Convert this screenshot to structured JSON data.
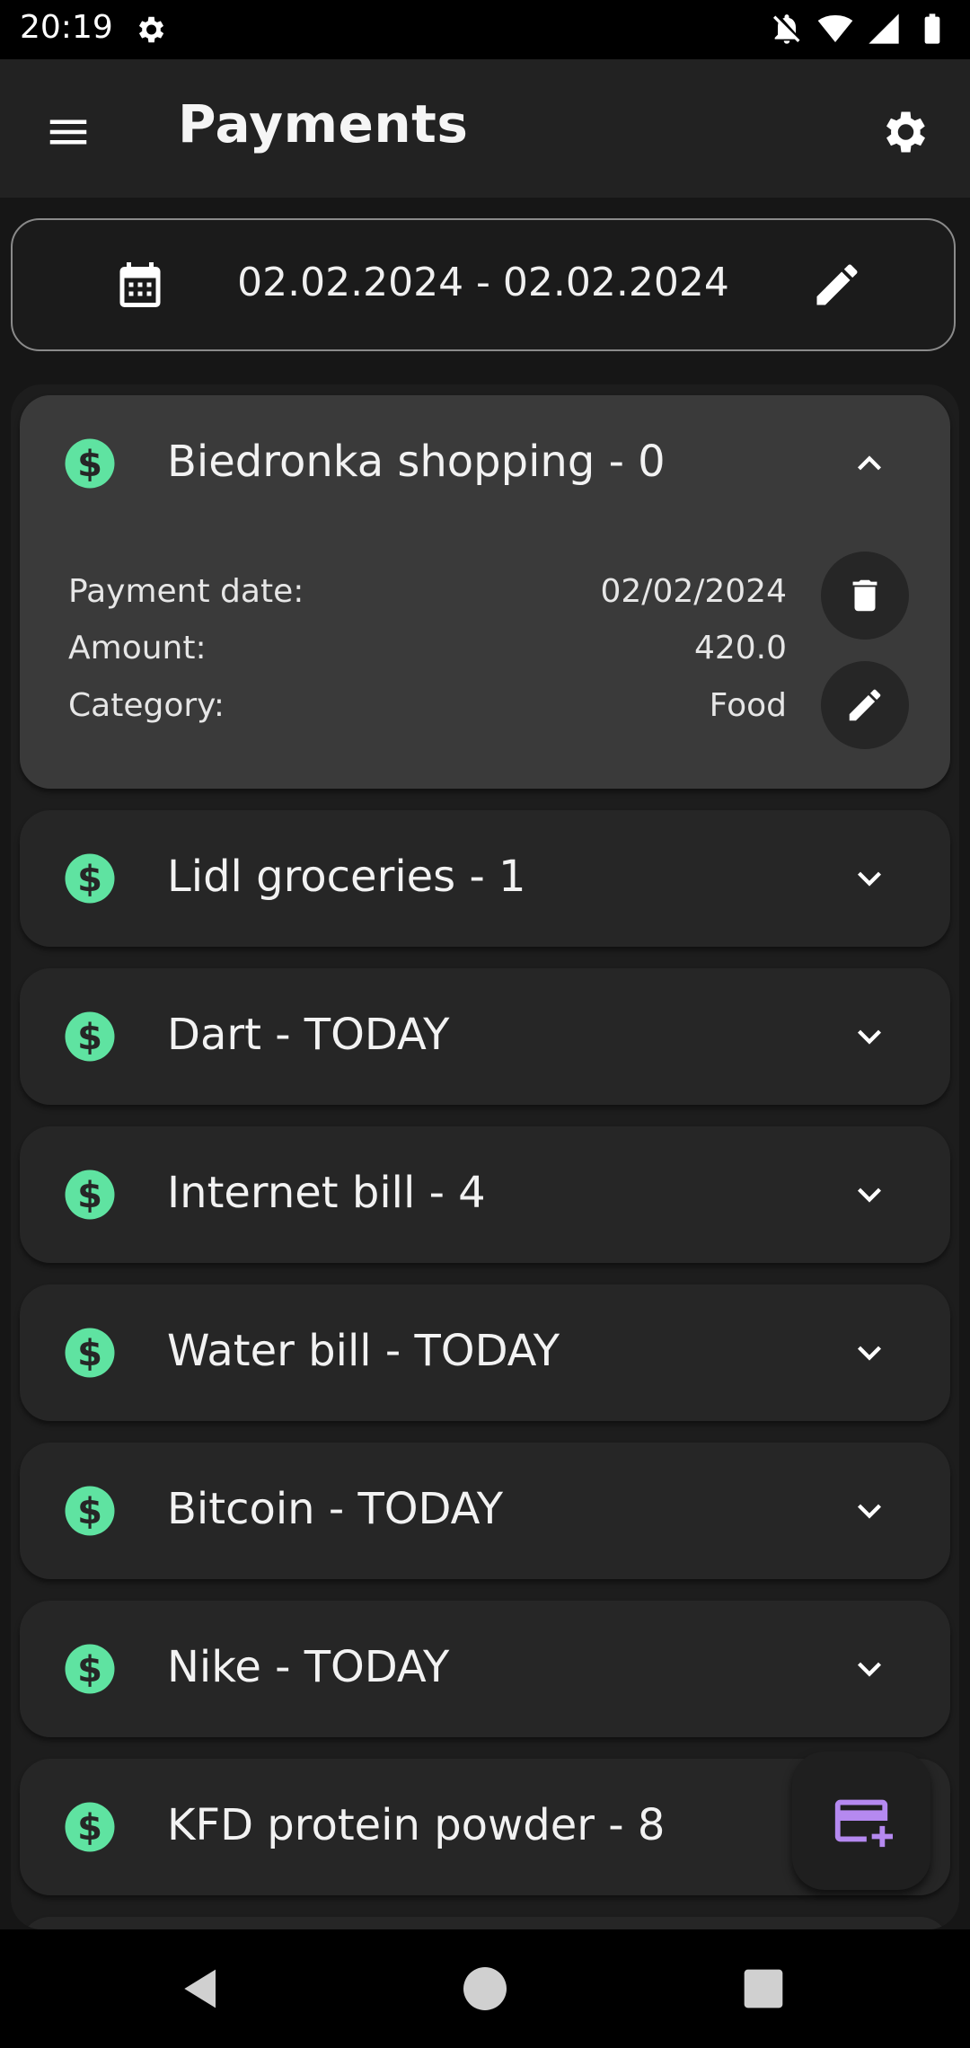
{
  "status_bar": {
    "time": "20:19"
  },
  "app_bar": {
    "title": "Payments"
  },
  "date_range": {
    "text": "02.02.2024 - 02.02.2024"
  },
  "colors": {
    "accent_green": "#5fe3a1",
    "fab_icon": "#b589f0",
    "card_bg": "#262626",
    "expanded_bg": "#3a3a3a"
  },
  "payments": [
    {
      "title": "Biedronka shopping - 0",
      "expanded": true,
      "details": [
        {
          "label": "Payment date:",
          "value": "02/02/2024"
        },
        {
          "label": "Amount:",
          "value": "420.0"
        },
        {
          "label": "Category:",
          "value": "Food"
        }
      ]
    },
    {
      "title": "Lidl groceries - 1"
    },
    {
      "title": "Dart - TODAY"
    },
    {
      "title": "Internet bill - 4"
    },
    {
      "title": "Water bill - TODAY"
    },
    {
      "title": "Bitcoin - TODAY"
    },
    {
      "title": "Nike - TODAY"
    },
    {
      "title": "KFD protein powder - 8"
    }
  ],
  "icons": {
    "status": [
      "settings-icon",
      "notifications-off-icon",
      "wifi-icon",
      "signal-icon",
      "battery-icon"
    ],
    "card": "dollar-circle-icon",
    "fab": "add-card-icon"
  }
}
